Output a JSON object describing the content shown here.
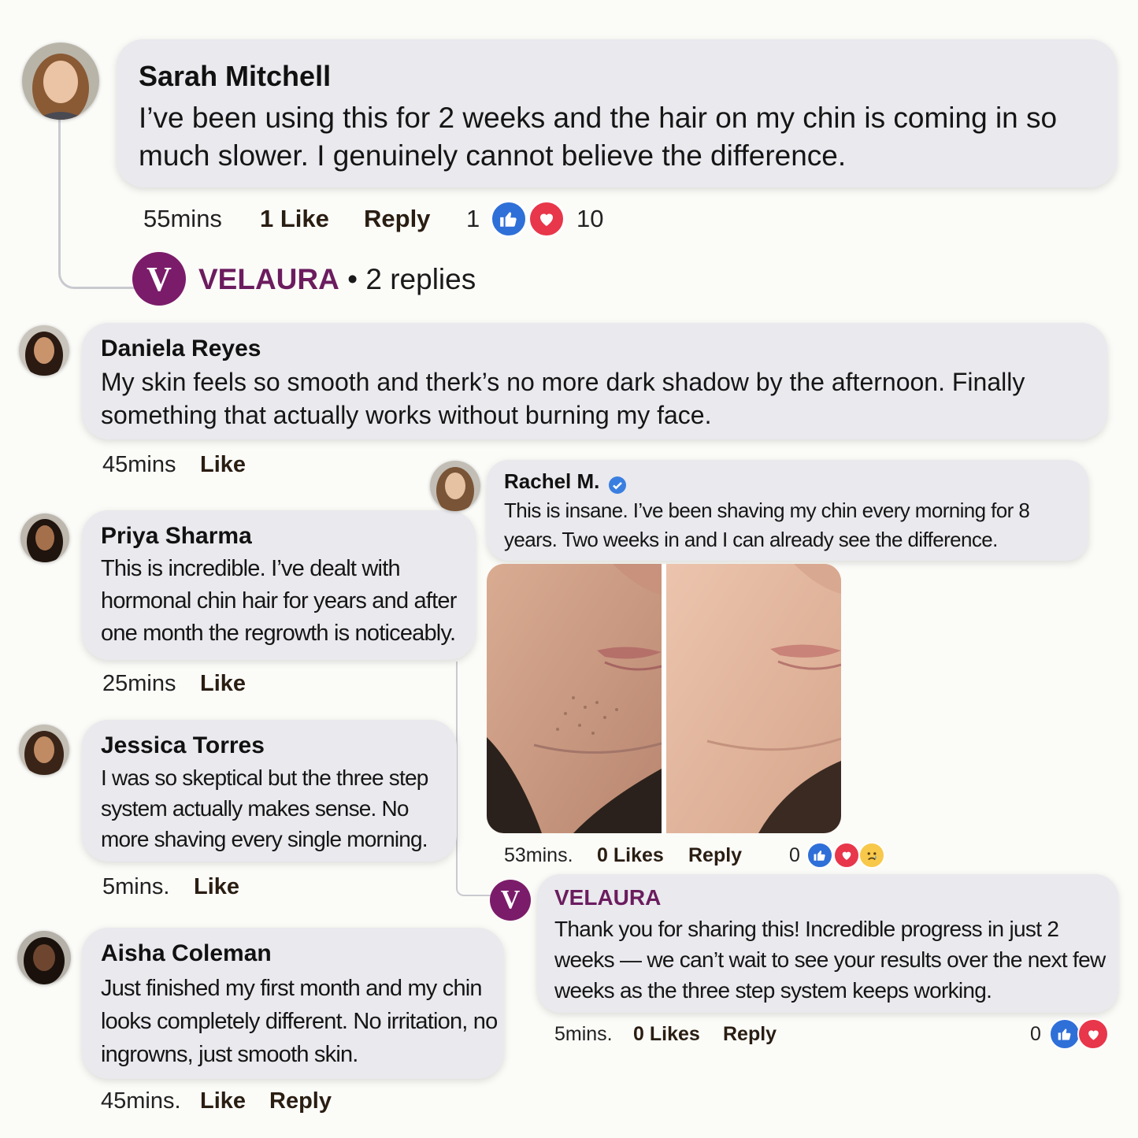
{
  "brand": {
    "name": "VELAURA",
    "logo_letter": "V",
    "color": "#7b1c6a"
  },
  "thread": {
    "replies_label": "• 2 replies"
  },
  "comments": {
    "sarah": {
      "author": "Sarah Mitchell",
      "text": "I’ve been using this for 2 weeks and the hair on my chin is coming in so much slower. I genuinely cannot believe the difference.",
      "time": "55mins",
      "like_label": "1 Like",
      "reply_label": "Reply",
      "like_count": "1",
      "love_count": "10"
    },
    "daniela": {
      "author": "Daniela Reyes",
      "text": "My skin feels so smooth and therk’s no more dark shadow by the afternoon. Finally something that actually works without burning my face.",
      "time": "45mins",
      "like_label": "Like"
    },
    "priya": {
      "author": "Priya Sharma",
      "text": "This is incredible. I’ve dealt with hormonal chin hair for years and after one month the regrowth is noticeably.",
      "time": "25mins",
      "like_label": "Like"
    },
    "jessica": {
      "author": "Jessica Torres",
      "text": "I was so skeptical but the three step system actually makes sense. No more shaving every single morning.",
      "time": "5mins.",
      "like_label": "Like"
    },
    "aisha": {
      "author": "Aisha Coleman",
      "text": "Just finished my first month and my chin looks completely different. No irritation, no ingrowns, just smooth skin.",
      "time": "45mins.",
      "like_label": "Like",
      "reply_label": "Reply"
    },
    "rachel": {
      "author": "Rachel M.",
      "verified": true,
      "text": "This is insane. I’ve been shaving my chin every morning for 8 years. Two weeks in and I can already see the difference.",
      "time": "53mins.",
      "likes_label": "0 Likes",
      "reply_label": "Reply",
      "reaction_count": "0"
    },
    "velaura_reply": {
      "author": "VELAURA",
      "text": "Thank you for sharing this! Incredible progress in just 2 weeks — we can’t wait to see your results over the next few weeks as the three step system keeps working.",
      "time": "5mins.",
      "likes_label": "0 Likes",
      "reply_label": "Reply",
      "reaction_count": "0"
    }
  },
  "icons": [
    "thumbs-up-reaction-icon",
    "heart-reaction-icon",
    "sad-reaction-icon",
    "verified-badge-icon"
  ],
  "colors": {
    "bubble": "#e9e9ee",
    "like": "#2f6fd8",
    "love": "#e8364a",
    "verified": "#3a7fe0"
  }
}
